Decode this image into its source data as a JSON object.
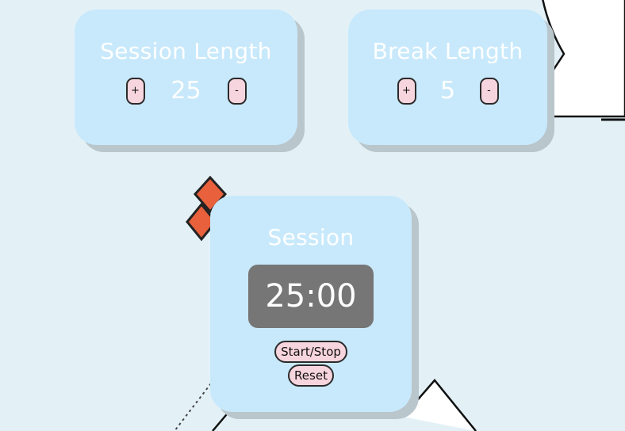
{
  "session_length": {
    "title": "Session Length",
    "increment_label": "+",
    "value": "25",
    "decrement_label": "-"
  },
  "break_length": {
    "title": "Break Length",
    "increment_label": "+",
    "value": "5",
    "decrement_label": "-"
  },
  "timer": {
    "label": "Session",
    "time": "25:00",
    "start_stop_label": "Start/Stop",
    "reset_label": "Reset"
  },
  "colors": {
    "background": "#e3f1f7",
    "card": "#c8e9fb",
    "button": "#f7d5df",
    "timer_display": "#767676",
    "diamond": "#e8613c"
  },
  "icons": [
    "decorative-circle-shape",
    "diamond-shapes",
    "triangle-shape",
    "dotted-line"
  ]
}
